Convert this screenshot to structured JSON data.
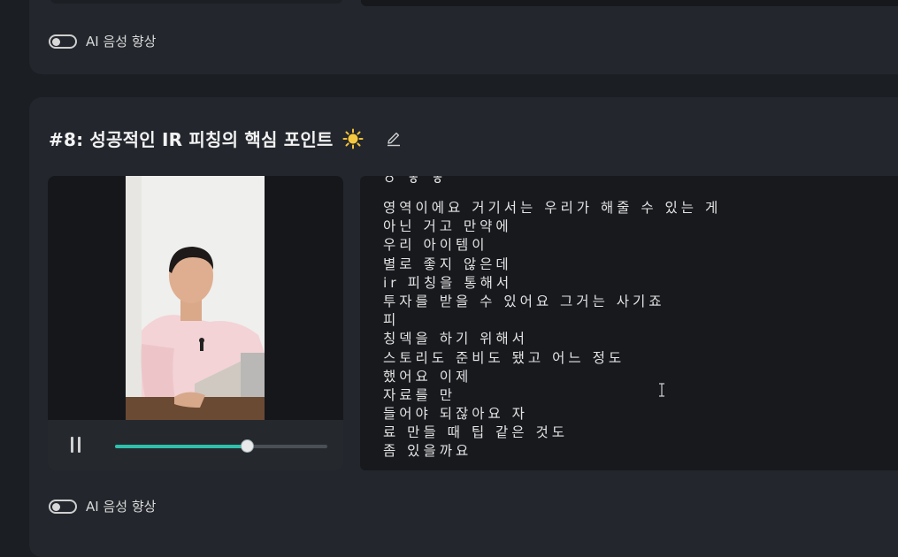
{
  "top_card": {
    "toggle_label": "AI 음성 향상"
  },
  "clip": {
    "title": "#8:  성공적인 IR 피칭의 핵심 포인트",
    "toggle_label": "AI 음성 향상",
    "playback_progress": 0.62,
    "transcript_lines": [
      "영역이에요 거기서는 우리가 해줄 수 있는 게",
      "아닌 거고 만약에",
      "우리 아이템이",
      "별로 좋지 않은데",
      "ir 피칭을 통해서",
      "투자를 받을 수 있어요 그거는 사기죠",
      "피",
      "칭덱을 하기 위해서",
      "스토리도 준비도 됐고 어느 정도",
      "했어요 이제",
      "자료를 만",
      "들어야 되잖아요 자",
      "료 만들 때 팁 같은 것도",
      "좀 있을까요"
    ]
  },
  "icons": {
    "title_emoji": "sun-icon",
    "edit": "pencil-icon",
    "play_state": "pause-icon"
  },
  "colors": {
    "accent": "#2fc0ac",
    "background": "#1b1e23",
    "card": "#23272d"
  }
}
